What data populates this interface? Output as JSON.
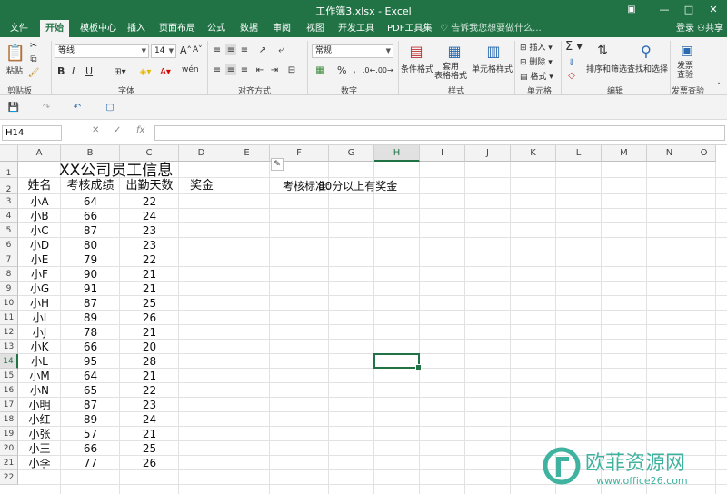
{
  "window": {
    "title": "工作簿3.xlsx - Excel",
    "restore_icon": "ribbon-display-icon",
    "minimize_label": "—",
    "maximize_label": "□",
    "close_label": "✕"
  },
  "tabs": [
    "文件",
    "开始",
    "模板中心",
    "插入",
    "页面布局",
    "公式",
    "数据",
    "审阅",
    "视图",
    "开发工具",
    "PDF工具集"
  ],
  "active_tab": "开始",
  "tellme": "告诉我您想要做什么...",
  "login": "登录",
  "share": "共享",
  "ribbon": {
    "clipboard": {
      "paste": "粘贴",
      "label": "剪贴板"
    },
    "font": {
      "name": "等线",
      "size": "14",
      "bold": "B",
      "italic": "I",
      "underline": "U",
      "label": "字体",
      "grow": "A",
      "shrink": "A",
      "wen": "wén"
    },
    "alignment": {
      "label": "对齐方式"
    },
    "number": {
      "format": "常规",
      "percent": "%",
      "comma": ",",
      "label": "数字"
    },
    "styles": {
      "conditional": "条件格式",
      "table": "套用\n表格格式",
      "cell": "单元格样式",
      "label": "样式"
    },
    "cells": {
      "insert": "插入",
      "delete": "删除",
      "format": "格式",
      "label": "单元格"
    },
    "editing": {
      "sort": "排序和筛选",
      "find": "查找和选择",
      "label": "编辑",
      "sigma": "Σ"
    },
    "review": {
      "check": "发票\n查验",
      "label": "发票查验"
    }
  },
  "formula_bar": {
    "name_box": "H14",
    "fx": "fx",
    "cancel": "✕",
    "enter": "✓",
    "value": ""
  },
  "columns": [
    "A",
    "B",
    "C",
    "D",
    "E",
    "F",
    "G",
    "H",
    "I",
    "J",
    "K",
    "L",
    "M",
    "N",
    "O"
  ],
  "rows": [
    "1",
    "2",
    "3",
    "4",
    "5",
    "6",
    "7",
    "8",
    "9",
    "10",
    "11",
    "12",
    "13",
    "14",
    "15",
    "16",
    "17",
    "18",
    "19",
    "20",
    "21",
    "22"
  ],
  "selected_cell": {
    "col": "H",
    "row": "14"
  },
  "sheet": {
    "title": "XX公司员工信息",
    "headers": [
      "姓名",
      "考核成绩",
      "出勤天数",
      "奖金"
    ],
    "note_label": "考核标准:",
    "note_value": "80分以上有奖金",
    "records": [
      [
        "小A",
        "64",
        "22"
      ],
      [
        "小B",
        "66",
        "24"
      ],
      [
        "小C",
        "87",
        "23"
      ],
      [
        "小D",
        "80",
        "23"
      ],
      [
        "小E",
        "79",
        "22"
      ],
      [
        "小F",
        "90",
        "21"
      ],
      [
        "小G",
        "91",
        "21"
      ],
      [
        "小H",
        "87",
        "25"
      ],
      [
        "小I",
        "89",
        "26"
      ],
      [
        "小J",
        "78",
        "21"
      ],
      [
        "小K",
        "66",
        "20"
      ],
      [
        "小L",
        "95",
        "28"
      ],
      [
        "小M",
        "64",
        "21"
      ],
      [
        "小N",
        "65",
        "22"
      ],
      [
        "小明",
        "87",
        "23"
      ],
      [
        "小红",
        "89",
        "24"
      ],
      [
        "小张",
        "57",
        "21"
      ],
      [
        "小王",
        "66",
        "25"
      ],
      [
        "小李",
        "77",
        "26"
      ]
    ]
  },
  "watermark": {
    "brand": "欧菲资源网",
    "url": "www.office26.com",
    "color": "#3fb3a0"
  }
}
